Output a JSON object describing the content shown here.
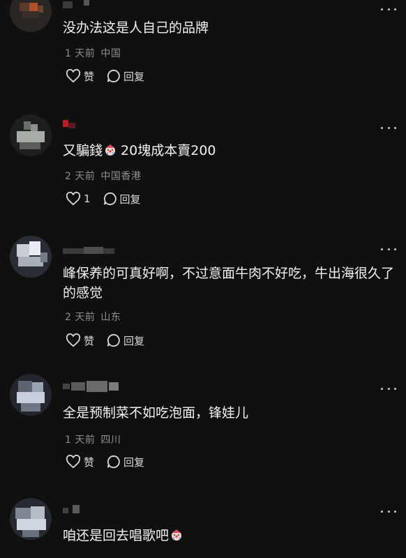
{
  "comments": [
    {
      "text": "没办法这是人自己的品牌",
      "time": "1 天前",
      "location": "中国",
      "like_label": "赞",
      "reply_label": "回复"
    },
    {
      "text": "又騙錢",
      "text_after_emoji": " 20塊成本賣200",
      "emoji": "crying-clown-emoji",
      "time": "2 天前",
      "location": "中国香港",
      "like_label": "1",
      "reply_label": "回复"
    },
    {
      "text": "峰保养的可真好啊，不过意面牛肉不好吃，牛出海很久了的感觉",
      "time": "2 天前",
      "location": "山东",
      "like_label": "赞",
      "reply_label": "回复"
    },
    {
      "text": "全是预制菜不如吃泡面，锋娃儿",
      "time": "1 天前",
      "location": "四川",
      "like_label": "赞",
      "reply_label": "回复"
    },
    {
      "text": "咱还是回去唱歌吧",
      "emoji": "crying-clown-emoji",
      "time": "",
      "location": "",
      "like_label": "",
      "reply_label": ""
    }
  ],
  "colors": {
    "background": "#101010",
    "text": "#f2f2f2",
    "meta": "#8e8e8e",
    "icon": "#d8d8d8"
  }
}
